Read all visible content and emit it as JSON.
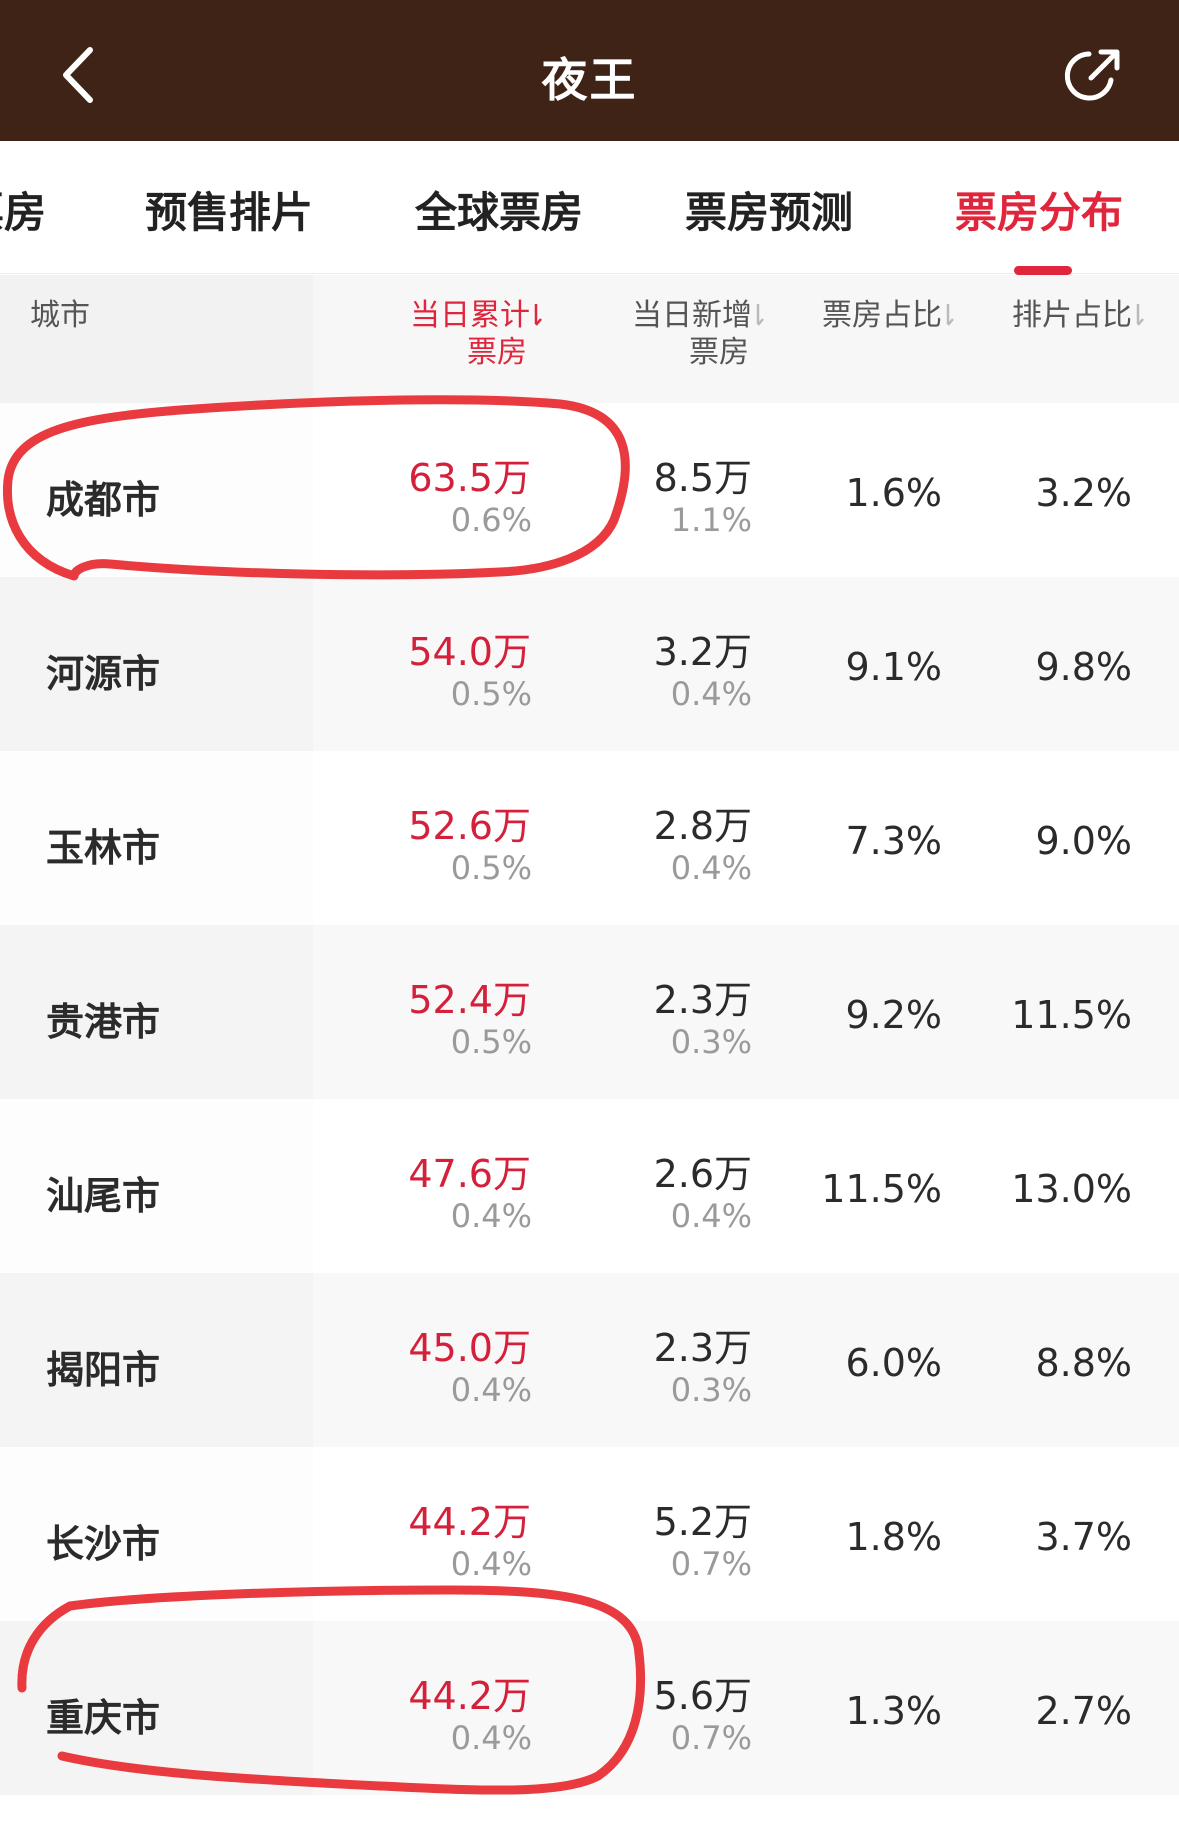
{
  "header": {
    "title": "夜王"
  },
  "tabs": [
    {
      "label": "票房",
      "active": false
    },
    {
      "label": "预售排片",
      "active": false
    },
    {
      "label": "全球票房",
      "active": false
    },
    {
      "label": "票房预测",
      "active": false
    },
    {
      "label": "票房分布",
      "active": true
    }
  ],
  "table": {
    "columns": {
      "city": "城市",
      "cumulative_line1": "当日累计",
      "cumulative_line2": "票房",
      "new_line1": "当日新增",
      "new_line2": "票房",
      "box_share": "票房占比",
      "schedule_share": "排片占比"
    },
    "rows": [
      {
        "city": "成都市",
        "cumulative": "63.5万",
        "cumulative_pct": "0.6%",
        "new": "8.5万",
        "new_pct": "1.1%",
        "box_share": "1.6%",
        "schedule_share": "3.2%"
      },
      {
        "city": "河源市",
        "cumulative": "54.0万",
        "cumulative_pct": "0.5%",
        "new": "3.2万",
        "new_pct": "0.4%",
        "box_share": "9.1%",
        "schedule_share": "9.8%"
      },
      {
        "city": "玉林市",
        "cumulative": "52.6万",
        "cumulative_pct": "0.5%",
        "new": "2.8万",
        "new_pct": "0.4%",
        "box_share": "7.3%",
        "schedule_share": "9.0%"
      },
      {
        "city": "贵港市",
        "cumulative": "52.4万",
        "cumulative_pct": "0.5%",
        "new": "2.3万",
        "new_pct": "0.3%",
        "box_share": "9.2%",
        "schedule_share": "11.5%"
      },
      {
        "city": "汕尾市",
        "cumulative": "47.6万",
        "cumulative_pct": "0.4%",
        "new": "2.6万",
        "new_pct": "0.4%",
        "box_share": "11.5%",
        "schedule_share": "13.0%"
      },
      {
        "city": "揭阳市",
        "cumulative": "45.0万",
        "cumulative_pct": "0.4%",
        "new": "2.3万",
        "new_pct": "0.3%",
        "box_share": "6.0%",
        "schedule_share": "8.8%"
      },
      {
        "city": "长沙市",
        "cumulative": "44.2万",
        "cumulative_pct": "0.4%",
        "new": "5.2万",
        "new_pct": "0.7%",
        "box_share": "1.8%",
        "schedule_share": "3.7%"
      },
      {
        "city": "重庆市",
        "cumulative": "44.2万",
        "cumulative_pct": "0.4%",
        "new": "5.6万",
        "new_pct": "0.7%",
        "box_share": "1.3%",
        "schedule_share": "2.7%"
      }
    ]
  },
  "colors": {
    "topbar": "#3f2316",
    "accent": "#e0263c",
    "annotation": "#e83a3f"
  },
  "icons": {
    "back": "chevron-left-icon",
    "share": "share-icon",
    "sort": "sort-down-icon"
  }
}
